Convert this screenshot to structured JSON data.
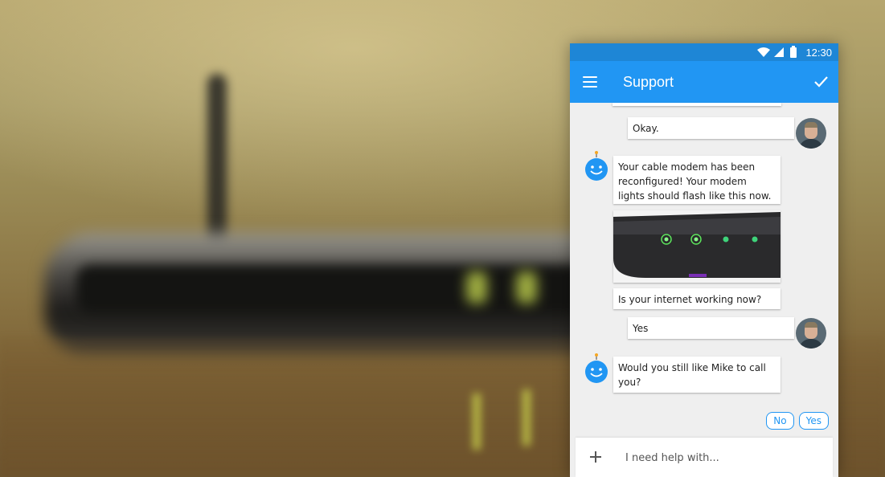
{
  "status_bar": {
    "time": "12:30"
  },
  "app_bar": {
    "title": "Support"
  },
  "messages": [
    {
      "sender": "user",
      "text": "Okay."
    },
    {
      "sender": "bot",
      "text": "Your cable modem has been reconfigured! Your modem lights should flash like this now."
    },
    {
      "sender": "bot",
      "text": "Is your internet working now?"
    },
    {
      "sender": "user",
      "text": "Yes"
    },
    {
      "sender": "bot",
      "text": "Would you still like Mike to call you?"
    }
  ],
  "quick_replies": {
    "no": "No",
    "yes": "Yes"
  },
  "composer": {
    "placeholder": "I need help with..."
  },
  "colors": {
    "primary": "#2196f3",
    "status_bar": "#1e86d6",
    "chat_bg": "#efefef"
  }
}
